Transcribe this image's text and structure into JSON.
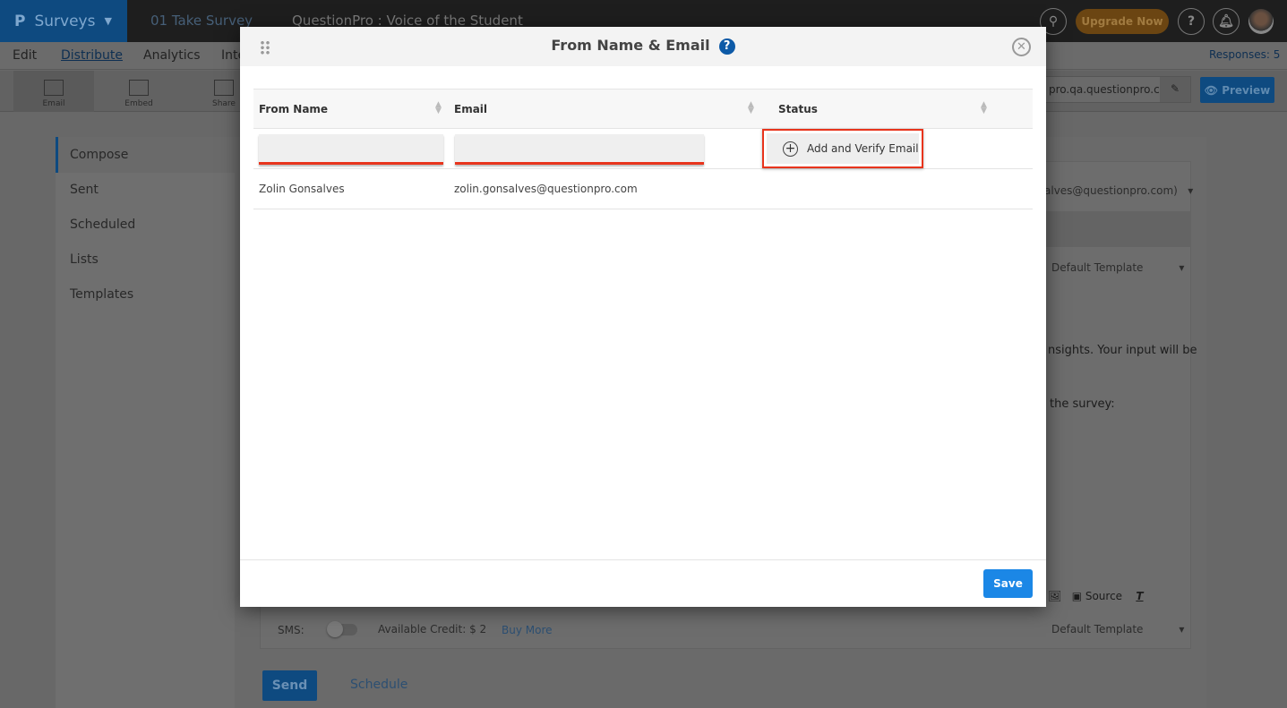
{
  "topbar": {
    "brand": "Surveys",
    "crumb1": "01 Take Survey",
    "crumb2": "QuestionPro : Voice of the Student",
    "upgrade": "Upgrade Now",
    "help": "?"
  },
  "nav": {
    "items": [
      "Edit",
      "Distribute",
      "Analytics",
      "Inte"
    ],
    "responses": "Responses: 5"
  },
  "toolbar": {
    "tools": [
      "Email",
      "Embed",
      "Share"
    ],
    "url": "pro.qa.questionpro.com",
    "preview": "Preview"
  },
  "sidebar": {
    "items": [
      "Compose",
      "Sent",
      "Scheduled",
      "Lists",
      "Templates"
    ]
  },
  "compose": {
    "from_value": "alves@questionpro.com)",
    "template1": "Default Template",
    "text1": "nsights. Your input will be",
    "text2": "the survey:",
    "source": "Source",
    "sms_label": "SMS:",
    "credit": "Available Credit: $ 2",
    "buy_more": "Buy More",
    "template2": "Default Template",
    "send": "Send",
    "schedule": "Schedule"
  },
  "modal": {
    "title": "From Name & Email",
    "help": "?",
    "columns": [
      "From Name",
      "Email",
      "Status"
    ],
    "inputs": {
      "name_value": "",
      "email_value": ""
    },
    "add_verify": "Add and Verify Email",
    "rows": [
      {
        "name": "Zolin Gonsalves",
        "email": "zolin.gonsalves@questionpro.com",
        "status": ""
      }
    ],
    "save": "Save"
  },
  "colors": {
    "accent": "#1b87e6",
    "highlight": "#e8341c",
    "help": "#0d5aa7"
  }
}
